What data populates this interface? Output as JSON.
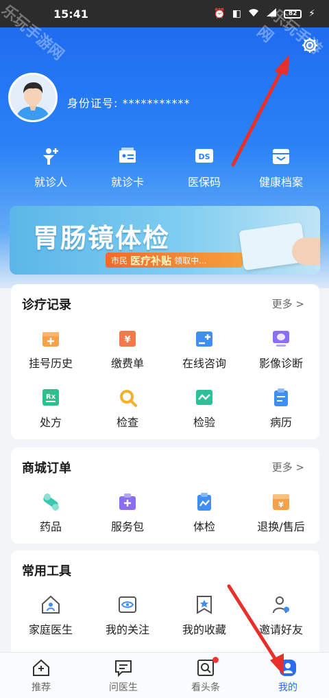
{
  "status_bar": {
    "time": "15:41",
    "battery": "82"
  },
  "profile": {
    "id_label": "身份证号: ***********"
  },
  "quick_actions": [
    {
      "label": "就诊人",
      "icon": "person-plus-icon"
    },
    {
      "label": "就诊卡",
      "icon": "card-icon"
    },
    {
      "label": "医保码",
      "icon": "insurance-code-icon"
    },
    {
      "label": "健康档案",
      "icon": "health-record-icon"
    }
  ],
  "banner": {
    "title": "胃肠镜体检",
    "tag_small": "市民",
    "tag_big": "医疗补贴",
    "tag_tail": "领取中..."
  },
  "sections": {
    "records": {
      "title": "诊疗记录",
      "more": "更多 >",
      "items": [
        {
          "label": "挂号历史",
          "icon": "calendar-icon",
          "color": "#f5a04a"
        },
        {
          "label": "缴费单",
          "icon": "payment-icon",
          "color": "#f07a4a"
        },
        {
          "label": "在线咨询",
          "icon": "consult-icon",
          "color": "#3f8ef2"
        },
        {
          "label": "影像诊断",
          "icon": "imaging-icon",
          "color": "#8a6ff0"
        },
        {
          "label": "处方",
          "icon": "prescription-icon",
          "color": "#2fbf8a"
        },
        {
          "label": "检查",
          "icon": "search-icon",
          "color": "#f5b02a"
        },
        {
          "label": "检验",
          "icon": "test-icon",
          "color": "#2fbf9a"
        },
        {
          "label": "病历",
          "icon": "clipboard-icon",
          "color": "#3f8ef2"
        }
      ]
    },
    "orders": {
      "title": "商城订单",
      "more": "更多 >",
      "items": [
        {
          "label": "药品",
          "icon": "pill-icon",
          "color": "#38c9b0"
        },
        {
          "label": "服务包",
          "icon": "service-pack-icon",
          "color": "#8a6ff0"
        },
        {
          "label": "体检",
          "icon": "checkup-icon",
          "color": "#3f8ef2"
        },
        {
          "label": "退换/售后",
          "icon": "refund-icon",
          "color": "#f5a04a"
        }
      ]
    },
    "tools": {
      "title": "常用工具",
      "items": [
        {
          "label": "家庭医生",
          "icon": "home-doctor-icon"
        },
        {
          "label": "我的关注",
          "icon": "eye-icon"
        },
        {
          "label": "我的收藏",
          "icon": "bookmark-star-icon"
        },
        {
          "label": "邀请好友",
          "icon": "invite-user-icon"
        }
      ]
    }
  },
  "tab_bar": [
    {
      "label": "推荐",
      "icon": "home-icon",
      "active": false
    },
    {
      "label": "问医生",
      "icon": "chat-icon",
      "active": false
    },
    {
      "label": "看头条",
      "icon": "news-icon",
      "active": false
    },
    {
      "label": "我的",
      "icon": "profile-icon",
      "active": true
    }
  ],
  "colors": {
    "primary": "#2a6df0",
    "header_top": "#1f6cf0",
    "arrow_red": "#e8302a"
  },
  "watermark": "乐玩手游网"
}
